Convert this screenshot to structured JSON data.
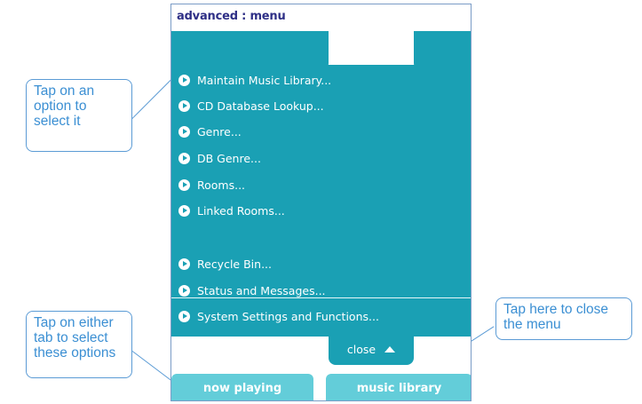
{
  "window": {
    "title": "advanced : menu"
  },
  "menu": {
    "group1": [
      {
        "label": "Maintain Music Library..."
      },
      {
        "label": "CD Database Lookup..."
      },
      {
        "label": "Genre..."
      },
      {
        "label": "DB Genre..."
      },
      {
        "label": "Rooms..."
      },
      {
        "label": "Linked Rooms..."
      }
    ],
    "group2": [
      {
        "label": "Recycle Bin..."
      },
      {
        "label": "Status and Messages..."
      },
      {
        "label": "System Settings and Functions..."
      }
    ],
    "close_label": "close",
    "close_icon": "triangle-up-icon"
  },
  "tabs": [
    {
      "label": "now playing"
    },
    {
      "label": "music library"
    }
  ],
  "callouts": {
    "select_option": "Tap on an option to select it",
    "select_tab": "Tap on either tab to select these options",
    "close_menu": "Tap here to close the menu"
  },
  "colors": {
    "teal": "#1aa0b4",
    "tab": "#63cdd9",
    "title": "#2e2f86",
    "callout": "#3b8fd3"
  }
}
